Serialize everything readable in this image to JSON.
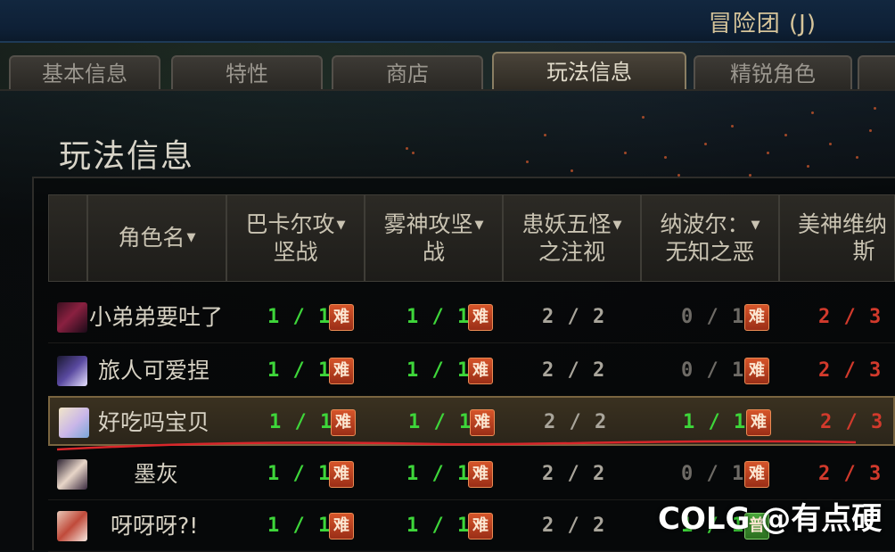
{
  "window": {
    "title": "冒险团 (J)"
  },
  "tabs": [
    {
      "label": "基本信息",
      "active": false
    },
    {
      "label": "特性",
      "active": false
    },
    {
      "label": "商店",
      "active": false
    },
    {
      "label": "玩法信息",
      "active": true
    },
    {
      "label": "精锐角色",
      "active": false
    }
  ],
  "panel": {
    "title": "玩法信息"
  },
  "table": {
    "columns": [
      {
        "label": "角色名"
      },
      {
        "label_line1": "巴卡尔攻",
        "label_line2": "坚战"
      },
      {
        "label_line1": "雾神攻坚",
        "label_line2": "战"
      },
      {
        "label_line1": "患妖五怪",
        "label_line2": "之注视"
      },
      {
        "label_line1": "纳波尔：",
        "label_line2": "无知之恶"
      },
      {
        "label_line1": "美神维纳",
        "label_line2": "斯"
      }
    ],
    "rows": [
      {
        "name": "小弟弟要吐了",
        "selected": false,
        "cells": [
          {
            "text": "1 / 1",
            "color": "green",
            "badge": "难"
          },
          {
            "text": "1 / 1",
            "color": "green",
            "badge": "难"
          },
          {
            "text": "2 / 2",
            "color": "white",
            "badge": ""
          },
          {
            "text": "0 / 1",
            "color": "gray",
            "badge": "难"
          },
          {
            "text": "2 / 3",
            "color": "red",
            "badge": ""
          }
        ]
      },
      {
        "name": "旅人可爱捏",
        "selected": false,
        "cells": [
          {
            "text": "1 / 1",
            "color": "green",
            "badge": "难"
          },
          {
            "text": "1 / 1",
            "color": "green",
            "badge": "难"
          },
          {
            "text": "2 / 2",
            "color": "white",
            "badge": ""
          },
          {
            "text": "0 / 1",
            "color": "gray",
            "badge": "难"
          },
          {
            "text": "2 / 3",
            "color": "red",
            "badge": ""
          }
        ]
      },
      {
        "name": "好吃吗宝贝",
        "selected": true,
        "cells": [
          {
            "text": "1 / 1",
            "color": "green",
            "badge": "难"
          },
          {
            "text": "1 / 1",
            "color": "green",
            "badge": "难"
          },
          {
            "text": "2 / 2",
            "color": "white",
            "badge": ""
          },
          {
            "text": "1 / 1",
            "color": "green",
            "badge": "难"
          },
          {
            "text": "2 / 3",
            "color": "red",
            "badge": ""
          }
        ]
      },
      {
        "name": "墨灰",
        "selected": false,
        "cells": [
          {
            "text": "1 / 1",
            "color": "green",
            "badge": "难"
          },
          {
            "text": "1 / 1",
            "color": "green",
            "badge": "难"
          },
          {
            "text": "2 / 2",
            "color": "white",
            "badge": ""
          },
          {
            "text": "0 / 1",
            "color": "gray",
            "badge": "难"
          },
          {
            "text": "2 / 3",
            "color": "red",
            "badge": ""
          }
        ]
      },
      {
        "name": "呀呀呀?!",
        "selected": false,
        "cells": [
          {
            "text": "1 / 1",
            "color": "green",
            "badge": "难"
          },
          {
            "text": "1 / 1",
            "color": "green",
            "badge": "难"
          },
          {
            "text": "2 / 2",
            "color": "white",
            "badge": ""
          },
          {
            "text": "1 / 1",
            "color": "green",
            "badge": "普"
          },
          {
            "text": "",
            "color": "green",
            "badge": ""
          }
        ]
      }
    ]
  },
  "watermark": {
    "text": "COLG @有点硬"
  },
  "colors": {
    "green": "#3ed63a",
    "red": "#d23a2c",
    "accent_border": "#7a6540",
    "badge_hard": "#c8461f",
    "badge_normal": "#3b8c2d"
  }
}
